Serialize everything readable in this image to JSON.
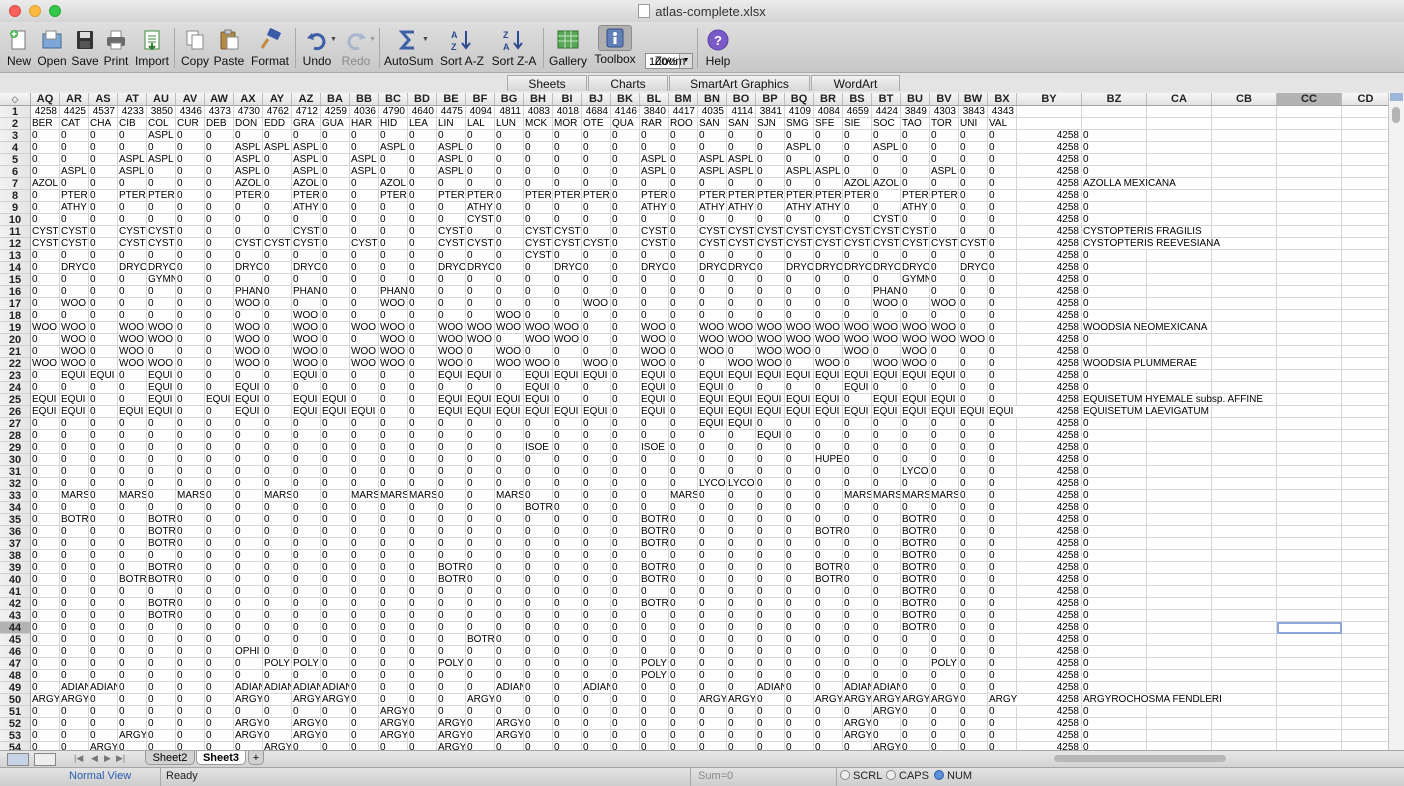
{
  "window": {
    "title": "atlas-complete.xlsx"
  },
  "colors": {
    "close": "#fc605c",
    "minimize": "#fdbc40",
    "zoom": "#34c84a",
    "selection": "#8ea9d8"
  },
  "toolbar": [
    {
      "id": "new",
      "label": "New",
      "icon": "new-icon",
      "enabled": true
    },
    {
      "id": "open",
      "label": "Open",
      "icon": "open-icon",
      "enabled": true
    },
    {
      "id": "save",
      "label": "Save",
      "icon": "save-icon",
      "enabled": true
    },
    {
      "id": "print",
      "label": "Print",
      "icon": "print-icon",
      "enabled": true
    },
    {
      "id": "import",
      "label": "Import",
      "icon": "import-icon",
      "enabled": true
    },
    {
      "id": "copy",
      "label": "Copy",
      "icon": "copy-icon",
      "enabled": true
    },
    {
      "id": "paste",
      "label": "Paste",
      "icon": "paste-icon",
      "enabled": true
    },
    {
      "id": "format",
      "label": "Format",
      "icon": "format-brush-icon",
      "enabled": true
    },
    {
      "id": "undo",
      "label": "Undo",
      "icon": "undo-icon",
      "enabled": true
    },
    {
      "id": "redo",
      "label": "Redo",
      "icon": "redo-icon",
      "enabled": false
    },
    {
      "id": "autosum",
      "label": "AutoSum",
      "icon": "sigma-icon",
      "enabled": true
    },
    {
      "id": "sort-az",
      "label": "Sort A-Z",
      "icon": "sort-az-icon",
      "enabled": true
    },
    {
      "id": "sort-za",
      "label": "Sort Z-A",
      "icon": "sort-za-icon",
      "enabled": true
    },
    {
      "id": "gallery",
      "label": "Gallery",
      "icon": "gallery-icon",
      "enabled": true
    },
    {
      "id": "toolbox",
      "label": "Toolbox",
      "icon": "toolbox-icon",
      "enabled": true
    },
    {
      "id": "zoom",
      "label": "Zoom",
      "icon": "zoom-icon",
      "enabled": true
    },
    {
      "id": "help",
      "label": "Help",
      "icon": "help-icon",
      "enabled": true
    }
  ],
  "zoom": {
    "value": "100%"
  },
  "ribbon_tabs": [
    "Sheets",
    "Charts",
    "SmartArt Graphics",
    "WordArt"
  ],
  "columns": [
    "AQ",
    "AR",
    "AS",
    "AT",
    "AU",
    "AV",
    "AW",
    "AX",
    "AY",
    "AZ",
    "BA",
    "BB",
    "BC",
    "BD",
    "BE",
    "BF",
    "BG",
    "BH",
    "BI",
    "BJ",
    "BK",
    "BL",
    "BM",
    "BN",
    "BO",
    "BP",
    "BQ",
    "BR",
    "BS",
    "BT",
    "BU",
    "BV",
    "BW",
    "BX",
    "BY",
    "BZ",
    "CA",
    "CB",
    "CC",
    "CD"
  ],
  "selected_column": "CC",
  "active_cell": {
    "col": "CC",
    "row": 44
  },
  "row1": [
    "4258",
    "4425",
    "4537",
    "4233",
    "3850",
    "4346",
    "4373",
    "4730",
    "4762",
    "4712",
    "4259",
    "4036",
    "4790",
    "4640",
    "4475",
    "4094",
    "4811",
    "4083",
    "4018",
    "4684",
    "4146",
    "3840",
    "4417",
    "4035",
    "4114",
    "3841",
    "4109",
    "4084",
    "4659",
    "4424",
    "3849",
    "4303",
    "3843",
    "4343"
  ],
  "row2": [
    "BER",
    "CAT",
    "CHA",
    "CIB",
    "COL",
    "CUR",
    "DEB",
    "DON",
    "EDD",
    "GRA",
    "GUA",
    "HAR",
    "HID",
    "LEA",
    "LIN",
    "LAL",
    "LUN",
    "MCK",
    "MOR",
    "OTE",
    "QUA",
    "RAR",
    "ROO",
    "SAN",
    "SAN",
    "SJN",
    "SMG",
    "SFE",
    "SIE",
    "SOC",
    "TAO",
    "TOR",
    "UNI",
    "VAL"
  ],
  "body_rows": [
    {
      "n": 3,
      "v": "0|0|0|0|ASPL|0|0|0|0|0|0|0|0|0|0|0|0|0|0|0|0|0|0|0|0|0|0|0|0|0|0|0|0|0",
      "by": "4258",
      "bz": "0"
    },
    {
      "n": 4,
      "v": "0|0|0|0|0|0|0|ASPL|ASPL|ASPL|0|0|ASPL|0|ASPL|0|0|0|0|0|0|0|0|0|0|0|ASPL|0|0|ASPL|0|0|0|0",
      "by": "4258",
      "bz": "0"
    },
    {
      "n": 5,
      "v": "0|0|0|ASPL|ASPL|0|0|ASPL|0|ASPL|0|ASPL|0|0|ASPL|0|0|0|0|0|0|ASPL|0|ASPL|ASPL|0|0|0|0|0|0|0|0|0",
      "by": "4258",
      "bz": "0"
    },
    {
      "n": 6,
      "v": "0|ASPL|0|ASPL|0|0|0|ASPL|0|ASPL|0|ASPL|0|0|ASPL|0|0|0|0|0|0|ASPL|0|ASPL|ASPL|0|ASPL|ASPL|0|0|0|ASPL|0|0",
      "by": "4258",
      "bz": "0"
    },
    {
      "n": 7,
      "v": "AZOL|0|0|0|0|0|0|AZOL|0|AZOL|0|0|AZOL|0|0|0|0|0|0|0|0|0|0|0|0|0|0|0|AZOL|AZOL|0|0|0|0",
      "by": "4258",
      "bz": "AZOLLA MEXICANA"
    },
    {
      "n": 8,
      "v": "0|PTER|0|PTER|PTER|0|0|PTER|0|PTER|0|0|PTER|0|PTER|PTER|0|PTER|PTER|PTER|0|PTER|0|PTER|PTER|PTER|PTER|PTER|PTER|0|PTER|PTER|0|0",
      "by": "4258",
      "bz": "0"
    },
    {
      "n": 9,
      "v": "0|ATHY|0|0|0|0|0|0|0|ATHY|0|0|0|0|0|ATHY|0|0|0|0|0|ATHY|0|ATHY|ATHY|0|ATHY|ATHY|0|0|ATHY|0|0|0",
      "by": "4258",
      "bz": "0"
    },
    {
      "n": 10,
      "v": "0|0|0|0|0|0|0|0|0|0|0|0|0|0|0|CYST|0|0|0|0|0|0|0|0|0|0|0|0|0|CYST|0|0|0|0",
      "by": "4258",
      "bz": "0"
    },
    {
      "n": 11,
      "v": "CYST|CYST|0|CYST|CYST|0|0|0|0|CYST|0|0|0|0|CYST|0|0|CYST|CYST|0|0|CYST|0|CYST|CYST|CYST|CYST|CYST|CYST|CYST|CYST|0|0|0",
      "by": "4258",
      "bz": "CYSTOPTERIS  FRAGILIS"
    },
    {
      "n": 12,
      "v": "CYST|CYST|0|CYST|CYST|0|0|CYST|CYST|CYST|0|CYST|0|0|CYST|CYST|0|CYST|CYST|CYST|0|CYST|0|CYST|CYST|CYST|CYST|CYST|CYST|CYST|CYST|CYST|CYST|0",
      "by": "4258",
      "bz": "CYSTOPTERIS  REEVESIANA"
    },
    {
      "n": 13,
      "v": "0|0|0|0|0|0|0|0|0|0|0|0|0|0|0|0|0|CYST|0|0|0|0|0|0|0|0|0|0|0|0|0|0|0|0",
      "by": "4258",
      "bz": "0"
    },
    {
      "n": 14,
      "v": "0|DRYO|0|DRYO|DRYO|0|0|DRYO|0|DRYO|0|0|0|0|DRYO|DRYO|0|0|DRYO|0|0|DRYO|0|DRYO|DRYO|0|DRYO|DRYO|DRYO|DRYO|DRYO|0|DRYO|0",
      "by": "4258",
      "bz": "0"
    },
    {
      "n": 15,
      "v": "0|0|0|0|GYMN|0|0|0|0|0|0|0|0|0|0|0|0|0|0|0|0|0|0|0|0|0|0|0|0|0|GYMN|0|0|0",
      "by": "4258",
      "bz": "0"
    },
    {
      "n": 16,
      "v": "0|0|0|0|0|0|0|PHAN|0|PHAN|0|0|PHAN|0|0|0|0|0|0|0|0|0|0|0|0|0|0|0|0|PHAN|0|0|0|0",
      "by": "4258",
      "bz": "0"
    },
    {
      "n": 17,
      "v": "0|WOO|0|0|0|0|0|WOO|0|0|0|0|WOO|0|0|0|0|0|0|WOO|0|0|0|0|0|0|0|0|0|WOO|0|WOO|0|0",
      "by": "4258",
      "bz": "0"
    },
    {
      "n": 18,
      "v": "0|0|0|0|0|0|0|0|0|WOO|0|0|0|0|0|0|WOO|0|0|0|0|0|0|0|0|0|0|0|0|0|0|0|0|0",
      "by": "4258",
      "bz": "0"
    },
    {
      "n": 19,
      "v": "WOO|WOO|0|WOO|WOO|0|0|WOO|0|WOO|0|WOO|WOO|0|WOO|WOO|WOO|WOO|WOO|0|0|WOO|0|WOO|WOO|WOO|WOO|WOO|WOO|WOO|WOO|WOO|0|0",
      "by": "4258",
      "bz": "WOODSIA NEOMEXICANA"
    },
    {
      "n": 20,
      "v": "0|WOO|0|WOO|WOO|0|0|WOO|0|WOO|0|0|WOO|0|WOO|WOO|0|WOO|WOO|0|0|WOO|0|WOO|WOO|WOO|WOO|WOO|WOO|WOO|WOO|WOO|WOO|0",
      "by": "4258",
      "bz": "0"
    },
    {
      "n": 21,
      "v": "0|WOO|0|WOO|0|0|0|WOO|0|WOO|0|WOO|WOO|0|WOO|0|WOO|0|0|0|0|WOO|0|WOO|0|WOO|WOO|0|WOO|0|WOO|0|0|0",
      "by": "4258",
      "bz": "0"
    },
    {
      "n": 22,
      "v": "WOO|WOO|0|WOO|WOO|0|0|WOO|0|WOO|0|WOO|WOO|0|WOO|0|WOO|WOO|0|WOO|0|WOO|0|0|WOO|WOO|0|WOO|0|WOO|WOO|0|0|0",
      "by": "4258",
      "bz": "WOODSIA PLUMMERAE"
    },
    {
      "n": 23,
      "v": "0|EQUI|EQUI|0|EQUI|0|0|0|0|EQUI|0|0|0|0|EQUI|EQUI|0|EQUI|EQUI|EQUI|0|EQUI|0|EQUI|EQUI|EQUI|EQUI|EQUI|EQUI|EQUI|EQUI|EQUI|0|0",
      "by": "4258",
      "bz": "0"
    },
    {
      "n": 24,
      "v": "0|0|0|0|EQUI|0|0|EQUI|0|0|0|0|0|0|0|0|0|EQUI|0|0|0|EQUI|0|EQUI|0|0|0|0|EQUI|0|0|0|0|0",
      "by": "4258",
      "bz": "0"
    },
    {
      "n": 25,
      "v": "EQUI|EQUI|0|0|EQUI|0|EQUI|EQUI|0|EQUI|EQUI|0|0|0|EQUI|EQUI|EQUI|EQUI|0|0|0|EQUI|0|EQUI|EQUI|EQUI|EQUI|EQUI|0|EQUI|EQUI|EQUI|0|0",
      "by": "4258",
      "bz": "EQUISETUM HYEMALE subsp. AFFINE"
    },
    {
      "n": 26,
      "v": "EQUI|EQUI|0|EQUI|EQUI|0|0|EQUI|0|EQUI|EQUI|EQUI|0|0|EQUI|EQUI|EQUI|EQUI|EQUI|EQUI|0|EQUI|0|EQUI|EQUI|EQUI|EQUI|EQUI|EQUI|EQUI|EQUI|EQUI|EQUI|EQUI",
      "by": "4258",
      "bz": "EQUISETUM LAEVIGATUM"
    },
    {
      "n": 27,
      "v": "0|0|0|0|0|0|0|0|0|0|0|0|0|0|0|0|0|0|0|0|0|0|0|EQUI|EQUI|0|0|0|0|0|0|0|0|0",
      "by": "4258",
      "bz": "0"
    },
    {
      "n": 28,
      "v": "0|0|0|0|0|0|0|0|0|0|0|0|0|0|0|0|0|0|0|0|0|0|0|0|0|EQUI|0|0|0|0|0|0|0|0",
      "by": "4258",
      "bz": "0"
    },
    {
      "n": 29,
      "v": "0|0|0|0|0|0|0|0|0|0|0|0|0|0|0|0|0|ISOE|0|0|0|ISOE|0|0|0|0|0|0|0|0|0|0|0|0",
      "by": "4258",
      "bz": "0"
    },
    {
      "n": 30,
      "v": "0|0|0|0|0|0|0|0|0|0|0|0|0|0|0|0|0|0|0|0|0|0|0|0|0|0|0|HUPE|0|0|0|0|0|0",
      "by": "4258",
      "bz": "0"
    },
    {
      "n": 31,
      "v": "0|0|0|0|0|0|0|0|0|0|0|0|0|0|0|0|0|0|0|0|0|0|0|0|0|0|0|0|0|0|LYCO|0|0|0",
      "by": "4258",
      "bz": "0"
    },
    {
      "n": 32,
      "v": "0|0|0|0|0|0|0|0|0|0|0|0|0|0|0|0|0|0|0|0|0|0|0|LYCO|LYCO|0|0|0|0|0|0|0|0|0",
      "by": "4258",
      "bz": "0"
    },
    {
      "n": 33,
      "v": "0|MARS|0|MARS|0|MARS|0|0|MARS|0|0|MARS|MARS|MARS|0|0|MARS|0|0|0|0|0|MARS|0|0|0|0|0|MARS|MARS|MARS|MARS|0|0",
      "by": "4258",
      "bz": "0"
    },
    {
      "n": 34,
      "v": "0|0|0|0|0|0|0|0|0|0|0|0|0|0|0|0|0|BOTR|0|0|0|0|0|0|0|0|0|0|0|0|0|0|0|0",
      "by": "4258",
      "bz": "0"
    },
    {
      "n": 35,
      "v": "0|BOTR|0|0|BOTR|0|0|0|0|0|0|0|0|0|0|0|0|0|0|0|0|BOTR|0|0|0|0|0|0|0|0|BOTR|0|0|0",
      "by": "4258",
      "bz": "0"
    },
    {
      "n": 36,
      "v": "0|0|0|0|BOTR|0|0|0|0|0|0|0|0|0|0|0|0|0|0|0|0|BOTR|0|0|0|0|0|BOTR|0|0|BOTR|0|0|0",
      "by": "4258",
      "bz": "0"
    },
    {
      "n": 37,
      "v": "0|0|0|0|BOTR|0|0|0|0|0|0|0|0|0|0|0|0|0|0|0|0|BOTR|0|0|0|0|0|0|0|0|BOTR|0|0|0",
      "by": "4258",
      "bz": "0"
    },
    {
      "n": 38,
      "v": "0|0|0|0|0|0|0|0|0|0|0|0|0|0|0|0|0|0|0|0|0|0|0|0|0|0|0|0|0|0|BOTR|0|0|0",
      "by": "4258",
      "bz": "0"
    },
    {
      "n": 39,
      "v": "0|0|0|0|BOTR|0|0|0|0|0|0|0|0|0|BOTR|0|0|0|0|0|0|BOTR|0|0|0|0|0|BOTR|0|0|BOTR|0|0|0",
      "by": "4258",
      "bz": "0"
    },
    {
      "n": 40,
      "v": "0|0|0|BOTR|BOTR|0|0|0|0|0|0|0|0|0|BOTR|0|0|0|0|0|0|BOTR|0|0|0|0|0|BOTR|0|0|BOTR|0|0|0",
      "by": "4258",
      "bz": "0"
    },
    {
      "n": 41,
      "v": "0|0|0|0|0|0|0|0|0|0|0|0|0|0|0|0|0|0|0|0|0|0|0|0|0|0|0|0|0|0|BOTR|0|0|0",
      "by": "4258",
      "bz": "0"
    },
    {
      "n": 42,
      "v": "0|0|0|0|BOTR|0|0|0|0|0|0|0|0|0|0|0|0|0|0|0|0|BOTR|0|0|0|0|0|0|0|0|BOTR|0|0|0",
      "by": "4258",
      "bz": "0"
    },
    {
      "n": 43,
      "v": "0|0|0|0|BOTR|0|0|0|0|0|0|0|0|0|0|0|0|0|0|0|0|0|0|0|0|0|0|0|0|0|BOTR|0|0|0",
      "by": "4258",
      "bz": "0"
    },
    {
      "n": 44,
      "v": "0|0|0|0|0|0|0|0|0|0|0|0|0|0|0|0|0|0|0|0|0|0|0|0|0|0|0|0|0|0|BOTR|0|0|0",
      "by": "4258",
      "bz": "0"
    },
    {
      "n": 45,
      "v": "0|0|0|0|0|0|0|0|0|0|0|0|0|0|0|BOTR|0|0|0|0|0|0|0|0|0|0|0|0|0|0|0|0|0|0",
      "by": "4258",
      "bz": "0"
    },
    {
      "n": 46,
      "v": "0|0|0|0|0|0|0|OPHI|0|0|0|0|0|0|0|0|0|0|0|0|0|0|0|0|0|0|0|0|0|0|0|0|0|0",
      "by": "4258",
      "bz": "0"
    },
    {
      "n": 47,
      "v": "0|0|0|0|0|0|0|0|POLY|POLY|0|0|0|0|POLY|0|0|0|0|0|0|POLY|0|0|0|0|0|0|0|0|0|POLY|0|0",
      "by": "4258",
      "bz": "0"
    },
    {
      "n": 48,
      "v": "0|0|0|0|0|0|0|0|0|0|0|0|0|0|0|0|0|0|0|0|0|POLY|0|0|0|0|0|0|0|0|0|0|0|0",
      "by": "4258",
      "bz": "0"
    },
    {
      "n": 49,
      "v": "0|ADIAN|ADIAN|0|0|0|0|ADIAN|ADIAN|ADIAN|ADIAN|0|0|0|0|0|ADIAN|0|0|ADIAN|0|0|0|0|0|ADIAN|0|0|ADIAN|ADIAN|0|0|0|0",
      "by": "4258",
      "bz": "0"
    },
    {
      "n": 50,
      "v": "ARGY|ARGY|0|0|0|0|0|ARGY|0|ARGY|ARGY|0|0|0|0|ARGY|0|0|0|0|0|0|0|ARGY|ARGY|0|0|ARGY|ARGY|ARGY|ARGY|ARGY|0|ARGY",
      "by": "4258",
      "bz": "ARGYROCHOSMA FENDLERI"
    },
    {
      "n": 51,
      "v": "0|0|0|0|0|0|0|0|0|0|0|0|ARGY|0|0|0|0|0|0|0|0|0|0|0|0|0|0|0|0|ARGY|0|0|0|0",
      "by": "4258",
      "bz": "0"
    },
    {
      "n": 52,
      "v": "0|0|0|0|0|0|0|ARGY|0|ARGY|0|0|ARGY|0|ARGY|0|ARGY|0|0|0|0|0|0|0|0|0|0|0|ARGY|0|0|0|0|0",
      "by": "4258",
      "bz": "0"
    },
    {
      "n": 53,
      "v": "0|0|0|ARGY|0|0|0|ARGY|0|ARGY|0|0|ARGY|0|ARGY|0|ARGY|0|0|0|0|0|0|0|0|0|0|0|ARGY|0|0|0|0|0",
      "by": "4258",
      "bz": "0"
    },
    {
      "n": 54,
      "v": "0|0|ARGY|0|0|0|0|0|ARGY|0|0|0|0|0|ARGY|0|0|0|0|0|0|0|0|0|0|0|0|0|0|ARGY|0|0|0|0",
      "by": "4258",
      "bz": "0"
    }
  ],
  "sheet_tabs": [
    {
      "label": "Sheet2",
      "active": false
    },
    {
      "label": "Sheet3",
      "active": true
    }
  ],
  "add_sheet": "+",
  "view_mode": "Normal View",
  "status": {
    "ready": "Ready",
    "sum": "Sum=0",
    "scrl": "SCRL",
    "caps": "CAPS",
    "num": "NUM"
  }
}
